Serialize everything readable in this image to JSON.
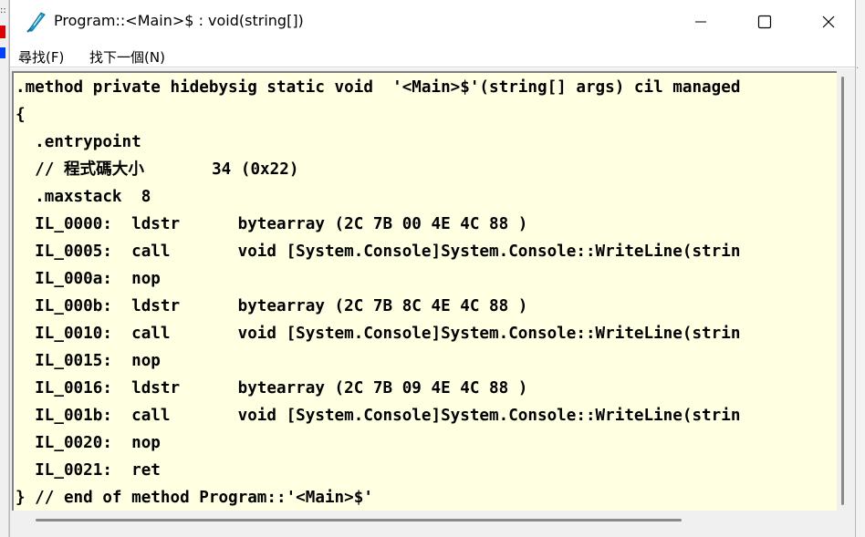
{
  "window": {
    "title": "Program::<Main>$ : void(string[])"
  },
  "menu": {
    "items": [
      {
        "label": "尋找(F)"
      },
      {
        "label": "找下一個(N)"
      }
    ]
  },
  "code": {
    "lines": [
      ".method private hidebysig static void  '<Main>$'(string[] args) cil managed",
      "{",
      "  .entrypoint",
      "  // 程式碼大小       34 (0x22)",
      "  .maxstack  8",
      "  IL_0000:  ldstr      bytearray (2C 7B 00 4E 4C 88 )",
      "  IL_0005:  call       void [System.Console]System.Console::WriteLine(strin",
      "  IL_000a:  nop",
      "  IL_000b:  ldstr      bytearray (2C 7B 8C 4E 4C 88 )",
      "  IL_0010:  call       void [System.Console]System.Console::WriteLine(strin",
      "  IL_0015:  nop",
      "  IL_0016:  ldstr      bytearray (2C 7B 09 4E 4C 88 )",
      "  IL_001b:  call       void [System.Console]System.Console::WriteLine(strin",
      "  IL_0020:  nop",
      "  IL_0021:  ret",
      "} // end of method Program::'<Main>$'"
    ]
  },
  "colors": {
    "code_background": "#ffffe1",
    "icon_accent": "#1aa3d9"
  },
  "icons": {
    "app": "feather-pen-icon",
    "minimize": "minimize-icon",
    "maximize": "maximize-icon",
    "close": "close-icon"
  }
}
